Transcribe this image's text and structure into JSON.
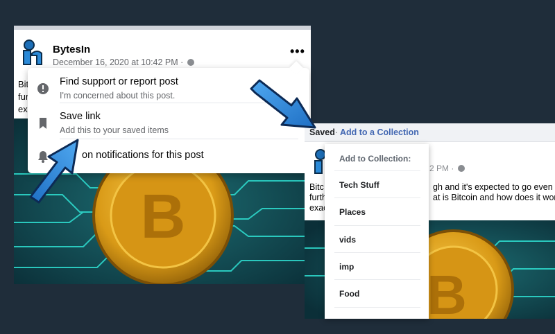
{
  "left_post": {
    "author": "BytesIn",
    "date": "December 16, 2020 at 10:42 PM · ",
    "more_label": "•••",
    "text_fragments": [
      "Bit",
      "fur",
      "ex"
    ]
  },
  "dropdown": {
    "items": [
      {
        "icon": "exclamation-circle-icon",
        "title": "Find support or report post",
        "subtitle": "I'm concerned about this post."
      },
      {
        "icon": "bookmark-icon",
        "title": "Save link",
        "subtitle": "Add this to your saved items"
      },
      {
        "icon": "bell-icon",
        "title": "on notifications for this post",
        "subtitle": ""
      }
    ]
  },
  "right_post": {
    "saved_label": "Saved",
    "separator": "·",
    "collection_link": "Add to a Collection",
    "date_fragment": "2 PM · ",
    "text_left": [
      "Bitc",
      "furth",
      "exac"
    ],
    "text_right": [
      "gh and it's expected to go even",
      "at is Bitcoin and how does it work"
    ]
  },
  "collection_menu": {
    "header": "Add to Collection:",
    "items": [
      "Tech Stuff",
      "Places",
      "vids",
      "imp",
      "Food"
    ]
  },
  "colors": {
    "background": "#1f2d3a",
    "link": "#4267b2",
    "arrow": "#2f86d6",
    "coin_gold": "#e0a21a",
    "circuit_teal": "#19b3ad"
  }
}
